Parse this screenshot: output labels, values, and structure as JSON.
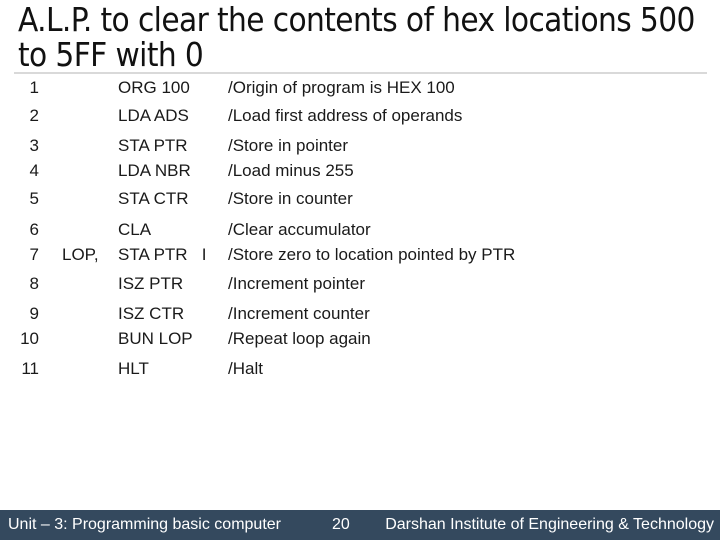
{
  "slide": {
    "title": "A.L.P. to clear the contents of hex locations 500 to 5FF with 0"
  },
  "program": [
    {
      "line": "1",
      "label": "",
      "instruction": "ORG 100",
      "comment": "/Origin of program is HEX 100"
    },
    {
      "line": "2",
      "label": "",
      "instruction": "LDA ADS",
      "comment": "/Load first address of operands"
    },
    {
      "line": "3",
      "label": "",
      "instruction": "STA PTR",
      "comment": "/Store in pointer"
    },
    {
      "line": "4",
      "label": "",
      "instruction": "LDA NBR",
      "comment": "/Load minus 255"
    },
    {
      "line": "5",
      "label": "",
      "instruction": "STA CTR",
      "comment": "/Store in counter"
    },
    {
      "line": "6",
      "label": "",
      "instruction": "CLA",
      "comment": "/Clear accumulator"
    },
    {
      "line": "7",
      "label": "LOP,",
      "instruction": "STA PTR   I",
      "comment": "/Store zero to location pointed by PTR"
    },
    {
      "line": "8",
      "label": "",
      "instruction": "ISZ PTR",
      "comment": "/Increment pointer"
    },
    {
      "line": "9",
      "label": "",
      "instruction": "ISZ CTR",
      "comment": "/Increment counter"
    },
    {
      "line": "10",
      "label": "",
      "instruction": "BUN LOP",
      "comment": "/Repeat loop again"
    },
    {
      "line": "11",
      "label": "",
      "instruction": "HLT",
      "comment": "/Halt"
    }
  ],
  "footer": {
    "unit": "Unit – 3: Programming basic computer",
    "page": "20",
    "institute": "Darshan Institute of Engineering & Technology",
    "background_color": "#34495e"
  }
}
